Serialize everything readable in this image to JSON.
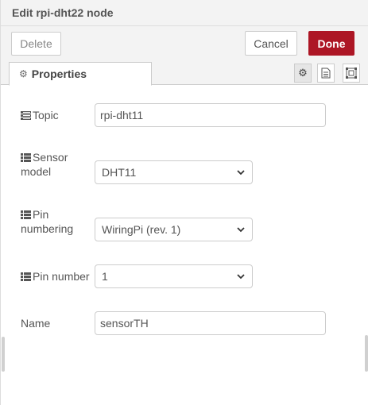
{
  "header": {
    "title": "Edit rpi-dht22 node"
  },
  "toolbar": {
    "delete_label": "Delete",
    "cancel_label": "Cancel",
    "done_label": "Done"
  },
  "tabs": {
    "properties_label": "Properties"
  },
  "form": {
    "topic": {
      "label": "Topic",
      "value": "rpi-dht11"
    },
    "sensor_model": {
      "label_line1": "Sensor",
      "label_line2": "model",
      "value": "DHT11"
    },
    "pin_numbering": {
      "label_line1": "Pin",
      "label_line2": "numbering",
      "value": "WiringPi (rev. 1)"
    },
    "pin_number": {
      "label": "Pin number",
      "value": "1"
    },
    "name": {
      "label": "Name",
      "value": "sensorTH"
    }
  },
  "icons": {
    "topic": "tasks-icon",
    "list": "list-icon",
    "tab": "gear-icon",
    "tab_buttons": [
      "gear-icon",
      "file-text-icon",
      "object-frame-icon"
    ],
    "select": "chevron-down-icon"
  },
  "colors": {
    "done": "#ad1625",
    "header_bg": "#f3f3f3",
    "border": "#cccccc"
  }
}
